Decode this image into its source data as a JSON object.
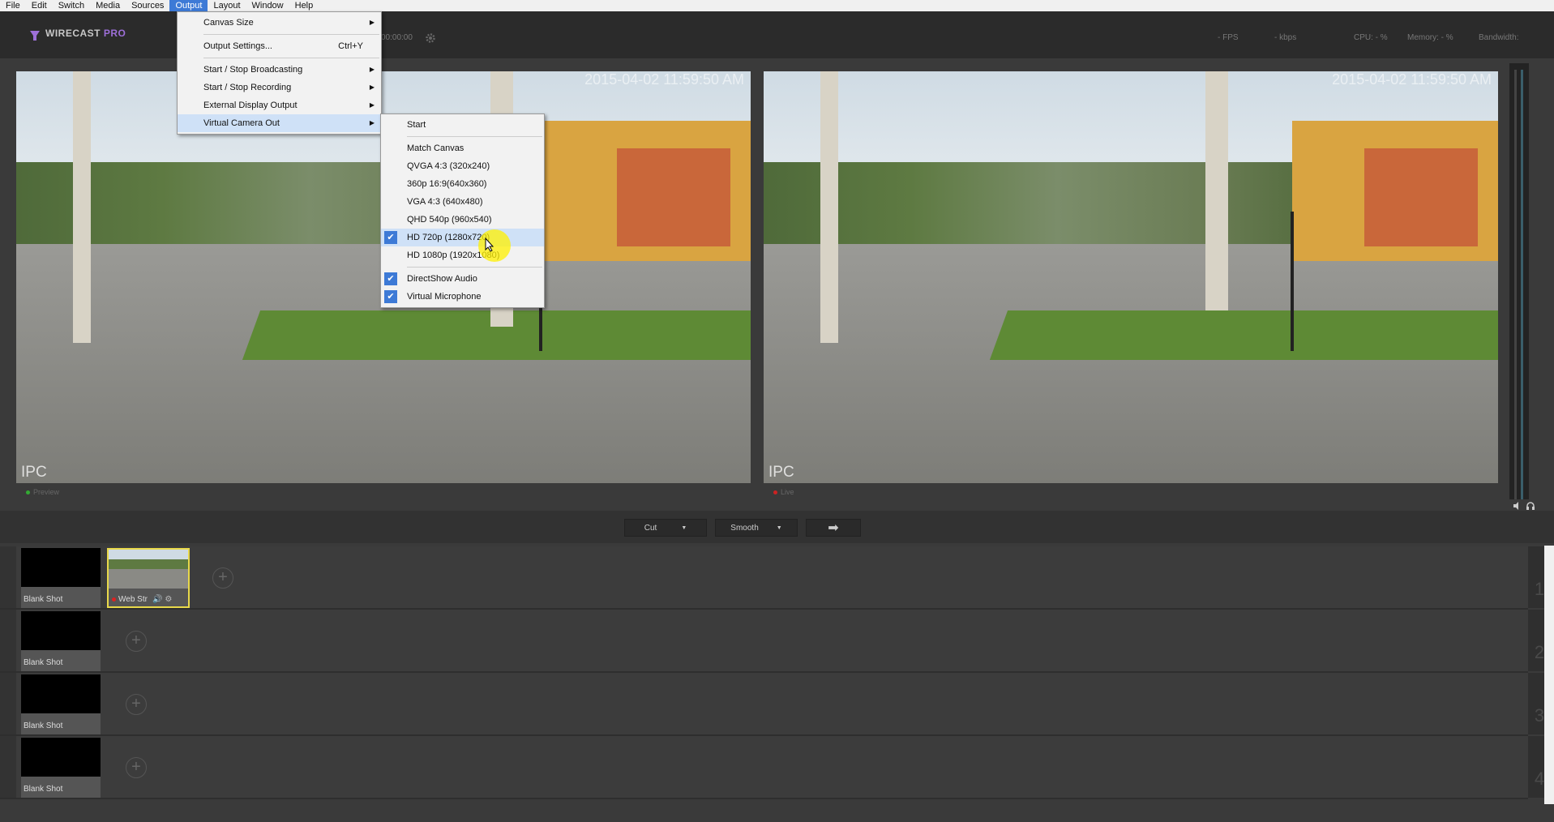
{
  "menubar": [
    "File",
    "Edit",
    "Switch",
    "Media",
    "Sources",
    "Output",
    "Layout",
    "Window",
    "Help"
  ],
  "app": {
    "name": "WIRECAST",
    "edition": "PRO",
    "timecode": "00:00:00"
  },
  "stats": {
    "fps": "- FPS",
    "kbps": "- kbps",
    "cpu": "CPU: - %",
    "memory": "Memory: - %",
    "bandwidth": "Bandwidth:"
  },
  "preview": {
    "timestamp": "2015-04-02 11:59:50 AM",
    "watermark": "IPC",
    "label": "Preview"
  },
  "live": {
    "timestamp": "2015-04-02 11:59:50 AM",
    "watermark": "IPC",
    "label": "Live"
  },
  "transition": {
    "cut": "Cut",
    "smooth": "Smooth",
    "go": "➡"
  },
  "output_menu": {
    "canvas_size": "Canvas Size",
    "output_settings": "Output Settings...",
    "output_settings_shortcut": "Ctrl+Y",
    "broadcasting": "Start / Stop Broadcasting",
    "recording": "Start / Stop Recording",
    "external_display": "External Display Output",
    "virtual_camera": "Virtual Camera Out"
  },
  "virtual_camera_menu": {
    "start": "Start",
    "match_canvas": "Match Canvas",
    "qvga": "QVGA 4:3 (320x240)",
    "p360": "360p 16:9(640x360)",
    "vga": "VGA 4:3 (640x480)",
    "qhd": "QHD 540p (960x540)",
    "hd720": "HD 720p (1280x720)",
    "hd1080": "HD 1080p (1920x1080)",
    "directshow_audio": "DirectShow Audio",
    "virtual_microphone": "Virtual Microphone"
  },
  "layers": [
    {
      "shots": [
        {
          "label": "Blank Shot"
        },
        {
          "label": "Web Str"
        }
      ],
      "number": "1"
    },
    {
      "shots": [
        {
          "label": "Blank Shot"
        }
      ],
      "number": "2"
    },
    {
      "shots": [
        {
          "label": "Blank Shot"
        }
      ],
      "number": "3"
    },
    {
      "shots": [
        {
          "label": "Blank Shot"
        }
      ],
      "number": "4"
    }
  ],
  "colors": {
    "accent": "#3d7ad6",
    "highlight": "#f0e040",
    "pro": "#9d6fd8"
  }
}
